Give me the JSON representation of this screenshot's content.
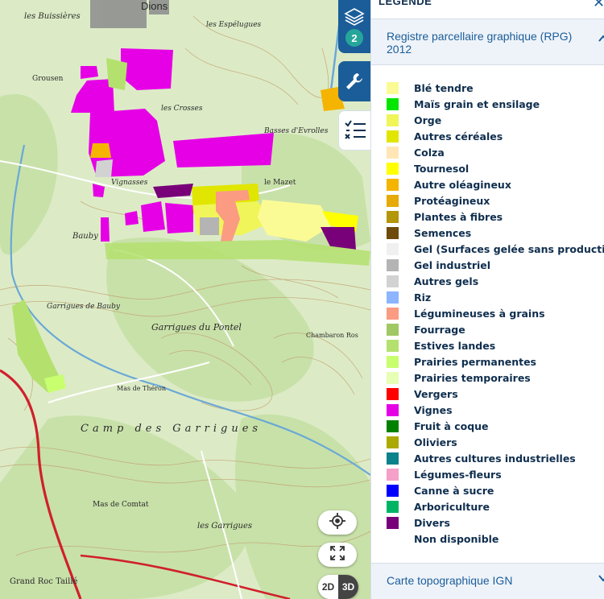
{
  "map": {
    "place_labels": [
      {
        "id": "les-buissieres",
        "text": "les Buissières"
      },
      {
        "id": "dions",
        "text": "Dions"
      },
      {
        "id": "espelugues",
        "text": "les Espélugues"
      },
      {
        "id": "grousen",
        "text": "Grousen"
      },
      {
        "id": "crosses",
        "text": "les Crosses"
      },
      {
        "id": "evrolles",
        "text": "Basses d'Evrolles"
      },
      {
        "id": "vignasses",
        "text": "Vignasses"
      },
      {
        "id": "le-mazet",
        "text": "le Mazet"
      },
      {
        "id": "bauby",
        "text": "Bauby"
      },
      {
        "id": "garrigues-bauby",
        "text": "Garrigues de Bauby"
      },
      {
        "id": "garrigues-pontel",
        "text": "Garrigues du Pontel"
      },
      {
        "id": "mas-theron",
        "text": "Mas de Théron"
      },
      {
        "id": "camp-garrigues",
        "text": "Camp des Garrigues"
      },
      {
        "id": "mas-comtat",
        "text": "Mas de Comtat"
      },
      {
        "id": "les-garrigues",
        "text": "les Garrigues"
      },
      {
        "id": "grand-roc",
        "text": "Grand Roc Taillé"
      },
      {
        "id": "chambaron",
        "text": "Chambaron Ros"
      }
    ],
    "colors": {
      "background": "#dcebc6",
      "forest": "#c5e0a5",
      "contour": "#c29a6b",
      "road_red": "#d0202b",
      "road_white": "#ffffff",
      "river": "#6aa8d6"
    }
  },
  "controls": {
    "layers_icon": "layers-icon",
    "layers_count": "2",
    "tools_icon": "wrench-icon",
    "legend_icon": "legend-list-icon",
    "locate_icon": "crosshair-icon",
    "fullscreen_icon": "fullscreen-icon",
    "view_2d": "2D",
    "view_3d": "3D"
  },
  "legend": {
    "title": "LÉGENDE",
    "close_icon": "close-icon",
    "layer_name": "Registre parcellaire graphique (RPG) 2012",
    "layer_toggle_icon": "chevron-up-icon",
    "items": [
      {
        "label": "Blé tendre",
        "color": "#fbfb96"
      },
      {
        "label": "Maïs grain et ensilage",
        "color": "#00e600"
      },
      {
        "label": "Orge",
        "color": "#f0f55a"
      },
      {
        "label": "Autres céréales",
        "color": "#e1e600"
      },
      {
        "label": "Colza",
        "color": "#ffe6b4"
      },
      {
        "label": "Tournesol",
        "color": "#ffff00"
      },
      {
        "label": "Autre oléagineux",
        "color": "#f5b400"
      },
      {
        "label": "Protéagineux",
        "color": "#e6aa0a"
      },
      {
        "label": "Plantes à fibres",
        "color": "#b4960a"
      },
      {
        "label": "Semences",
        "color": "#6e4b0a"
      },
      {
        "label": "Gel (Surfaces gelée sans production)",
        "color": "#f0f0f0"
      },
      {
        "label": "Gel industriel",
        "color": "#b4b4b4"
      },
      {
        "label": "Autres gels",
        "color": "#d2d2d2"
      },
      {
        "label": "Riz",
        "color": "#8cb4ff"
      },
      {
        "label": "Légumineuses à grains",
        "color": "#fa9b82"
      },
      {
        "label": "Fourrage",
        "color": "#a0c864"
      },
      {
        "label": "Estives landes",
        "color": "#b4e16e"
      },
      {
        "label": "Prairies permanentes",
        "color": "#c8ff6e"
      },
      {
        "label": "Prairies temporaires",
        "color": "#e6ffb4"
      },
      {
        "label": "Vergers",
        "color": "#ff0000"
      },
      {
        "label": "Vignes",
        "color": "#e600e6"
      },
      {
        "label": "Fruit à coque",
        "color": "#008200"
      },
      {
        "label": "Oliviers",
        "color": "#aaaa00"
      },
      {
        "label": "Autres cultures industrielles",
        "color": "#0a828c"
      },
      {
        "label": "Légumes-fleurs",
        "color": "#f5a0c8"
      },
      {
        "label": "Canne à sucre",
        "color": "#0000ff"
      },
      {
        "label": "Arboriculture",
        "color": "#00b464"
      },
      {
        "label": "Divers",
        "color": "#780078"
      },
      {
        "label": "Non disponible",
        "color": "#ffffff"
      }
    ],
    "layer2_name": "Carte topographique IGN",
    "layer2_toggle_icon": "chevron-down-icon"
  }
}
